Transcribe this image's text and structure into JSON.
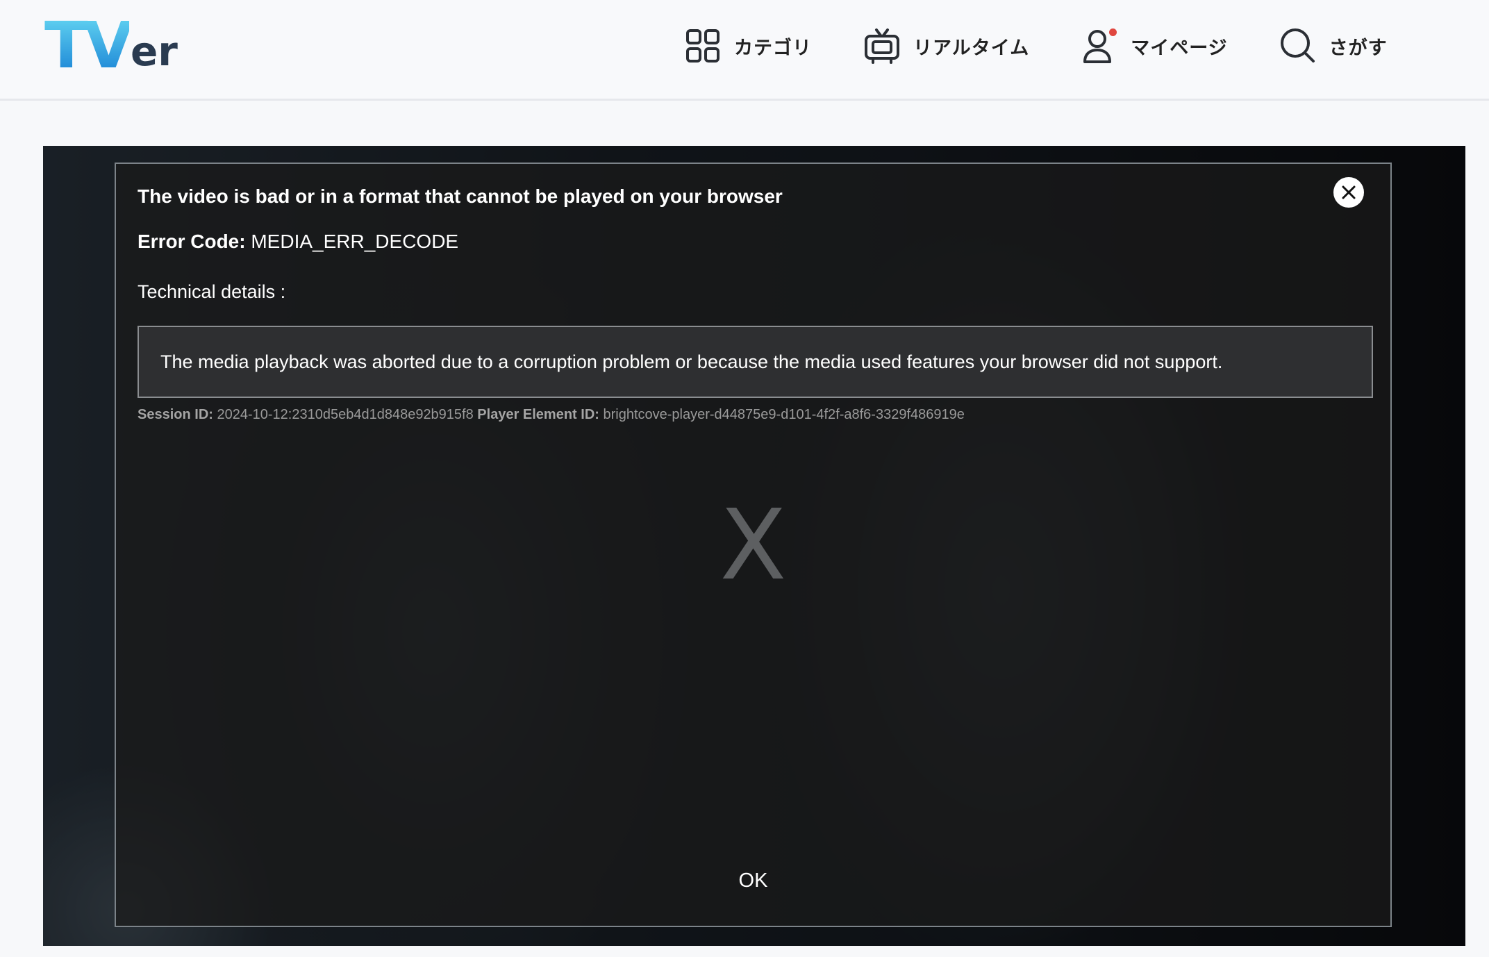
{
  "header": {
    "logo": {
      "main": "TV",
      "suffix": "er"
    },
    "nav": [
      {
        "label": "カテゴリ",
        "icon": "grid-icon"
      },
      {
        "label": "リアルタイム",
        "icon": "tv-icon"
      },
      {
        "label": "マイページ",
        "icon": "user-icon"
      },
      {
        "label": "さがす",
        "icon": "search-icon"
      }
    ]
  },
  "error_dialog": {
    "title": "The video is bad or in a format that cannot be played on your browser",
    "code_label": "Error Code:",
    "code_value": "MEDIA_ERR_DECODE",
    "tech_label": "Technical details :",
    "tech_message": "The media playback was aborted due to a corruption problem or because the media used features your browser did not support.",
    "session_label": "Session ID:",
    "session_value": "2024-10-12:2310d5eb4d1d848e92b915f8",
    "player_label": "Player Element ID:",
    "player_value": "brightcove-player-d44875e9-d101-4f2f-a8f6-3329f486919e",
    "big_x": "X",
    "ok_label": "OK",
    "close_icon": "close-icon"
  },
  "colors": {
    "logo_gradient_top": "#5fd0f0",
    "logo_gradient_bottom": "#1c86d6",
    "notification_dot": "#e0473f"
  }
}
